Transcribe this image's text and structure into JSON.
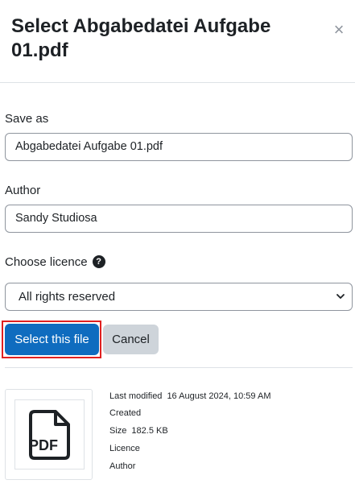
{
  "dialog": {
    "title": "Select Abgabedatei Aufgabe 01.pdf",
    "close_glyph": "×"
  },
  "form": {
    "save_as_label": "Save as",
    "save_as_value": "Abgabedatei Aufgabe 01.pdf",
    "author_label": "Author",
    "author_value": "Sandy Studiosa",
    "licence_label": "Choose licence",
    "licence_help_glyph": "?",
    "licence_selected": "All rights reserved"
  },
  "buttons": {
    "select_label": "Select this file",
    "cancel_label": "Cancel"
  },
  "file_info": {
    "icon_text": "PDF",
    "last_modified_label": "Last modified",
    "last_modified_value": "16 August 2024, 10:59 AM",
    "created_label": "Created",
    "size_label": "Size",
    "size_value": "182.5 KB",
    "licence_label": "Licence",
    "author_label": "Author"
  },
  "colors": {
    "primary": "#0f6cbf",
    "secondary": "#ced4da",
    "focus": "#e02020"
  }
}
